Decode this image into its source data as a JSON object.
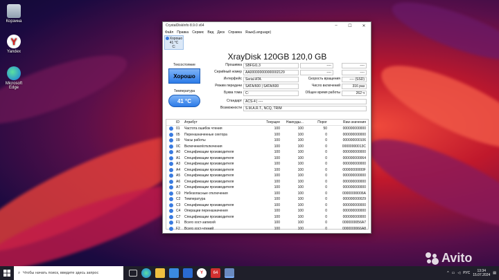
{
  "desktop": {
    "icons": [
      {
        "label": "Корзина",
        "name": "recycle-bin-icon"
      },
      {
        "label": "Yandex",
        "name": "yandex-browser-icon"
      },
      {
        "label": "Microsoft Edge",
        "name": "edge-icon"
      }
    ]
  },
  "window": {
    "title": "CrystalDiskInfo 8.9.0 x64",
    "menu": [
      "Файл",
      "Правка",
      "Сервис",
      "Вид",
      "Диск",
      "Справка",
      "Язык(Language)"
    ],
    "drive_tab": {
      "status": "Хорошо",
      "temp": "41 °C",
      "letter": "C:"
    },
    "model": "XrayDisk 120GB 120,0 GB",
    "health_label": "Техсостояние",
    "health_value": "Хорошо",
    "temp_label": "Температура",
    "temp_value": "41 °C",
    "fields": {
      "firmware_label": "Прошивка",
      "firmware": "SBFGI1.3",
      "serial_label": "Серийный номер",
      "serial": "AA000000000000002129",
      "interface_label": "Интерфейс",
      "interface": "Serial ATA",
      "transfer_label": "Режим передачи",
      "transfer": "SATA/600 | SATA/600",
      "letter_label": "Буква тома",
      "letter": "C:",
      "standard_label": "Стандарт",
      "standard": "ACS-4 | ----",
      "features_label": "Возможности",
      "features": "S.M.A.R.T., NCQ, TRIM",
      "r1_left": "----",
      "r1_right": "----",
      "r2_left": "----",
      "r2_right": "----",
      "rotation_label": "Скорость вращения",
      "rotation": "---- (SSD)",
      "power_count_label": "Число включений",
      "power_count": "316 раз",
      "power_hours_label": "Общее время работы",
      "power_hours": "262 ч"
    },
    "attr_headers": {
      "id": "ID",
      "name": "Атрибут",
      "current": "Текущее",
      "worst": "Наихудш...",
      "threshold": "Порог",
      "raw": "Raw-значения"
    },
    "attributes": [
      {
        "id": "01",
        "name": "Частота ошибок чтения",
        "current": "100",
        "worst": "100",
        "threshold": "50",
        "raw": "000000000000"
      },
      {
        "id": "05",
        "name": "Переназначенные сектора",
        "current": "100",
        "worst": "100",
        "threshold": "0",
        "raw": "000000000000"
      },
      {
        "id": "09",
        "name": "Часы работы",
        "current": "100",
        "worst": "100",
        "threshold": "0",
        "raw": "000000000106"
      },
      {
        "id": "0C",
        "name": "Включения/отключения",
        "current": "100",
        "worst": "100",
        "threshold": "0",
        "raw": "00000000013C"
      },
      {
        "id": "A0",
        "name": "Спецификации производителя",
        "current": "100",
        "worst": "100",
        "threshold": "0",
        "raw": "000000000000"
      },
      {
        "id": "A1",
        "name": "Спецификации производителя",
        "current": "100",
        "worst": "100",
        "threshold": "0",
        "raw": "000000000064"
      },
      {
        "id": "A3",
        "name": "Спецификации производителя",
        "current": "100",
        "worst": "100",
        "threshold": "0",
        "raw": "000000000000"
      },
      {
        "id": "A4",
        "name": "Спецификации производителя",
        "current": "100",
        "worst": "100",
        "threshold": "0",
        "raw": "00000000000F"
      },
      {
        "id": "A5",
        "name": "Спецификации производителя",
        "current": "100",
        "worst": "100",
        "threshold": "0",
        "raw": "000000000000"
      },
      {
        "id": "A6",
        "name": "Спецификации производителя",
        "current": "100",
        "worst": "100",
        "threshold": "0",
        "raw": "000000000000"
      },
      {
        "id": "A7",
        "name": "Спецификации производителя",
        "current": "100",
        "worst": "100",
        "threshold": "0",
        "raw": "000000000000"
      },
      {
        "id": "C0",
        "name": "Небезопасные отключения",
        "current": "100",
        "worst": "100",
        "threshold": "0",
        "raw": "00000000006A"
      },
      {
        "id": "C2",
        "name": "Температура",
        "current": "100",
        "worst": "100",
        "threshold": "0",
        "raw": "000000000029"
      },
      {
        "id": "C3",
        "name": "Спецификации производителя",
        "current": "100",
        "worst": "100",
        "threshold": "0",
        "raw": "000000000000"
      },
      {
        "id": "C4",
        "name": "Операции переназначения",
        "current": "100",
        "worst": "100",
        "threshold": "0",
        "raw": "000000000000"
      },
      {
        "id": "C7",
        "name": "Спецификации производителя",
        "current": "100",
        "worst": "100",
        "threshold": "0",
        "raw": "000000000000"
      },
      {
        "id": "F1",
        "name": "Всего хост-записей",
        "current": "100",
        "worst": "100",
        "threshold": "0",
        "raw": "0000000056A7"
      },
      {
        "id": "F2",
        "name": "Всего хост-чтений",
        "current": "100",
        "worst": "100",
        "threshold": "0",
        "raw": "0000000066A8"
      }
    ]
  },
  "taskbar": {
    "search_placeholder": "Чтобы начать поиск, введите здесь запрос",
    "badge": "64",
    "lang": "РУС",
    "time": "13:34",
    "date": "15.07.2024"
  },
  "watermark": "Avito",
  "colors": {
    "accent": "#2c7be8",
    "status_good": "#3a7be0"
  }
}
